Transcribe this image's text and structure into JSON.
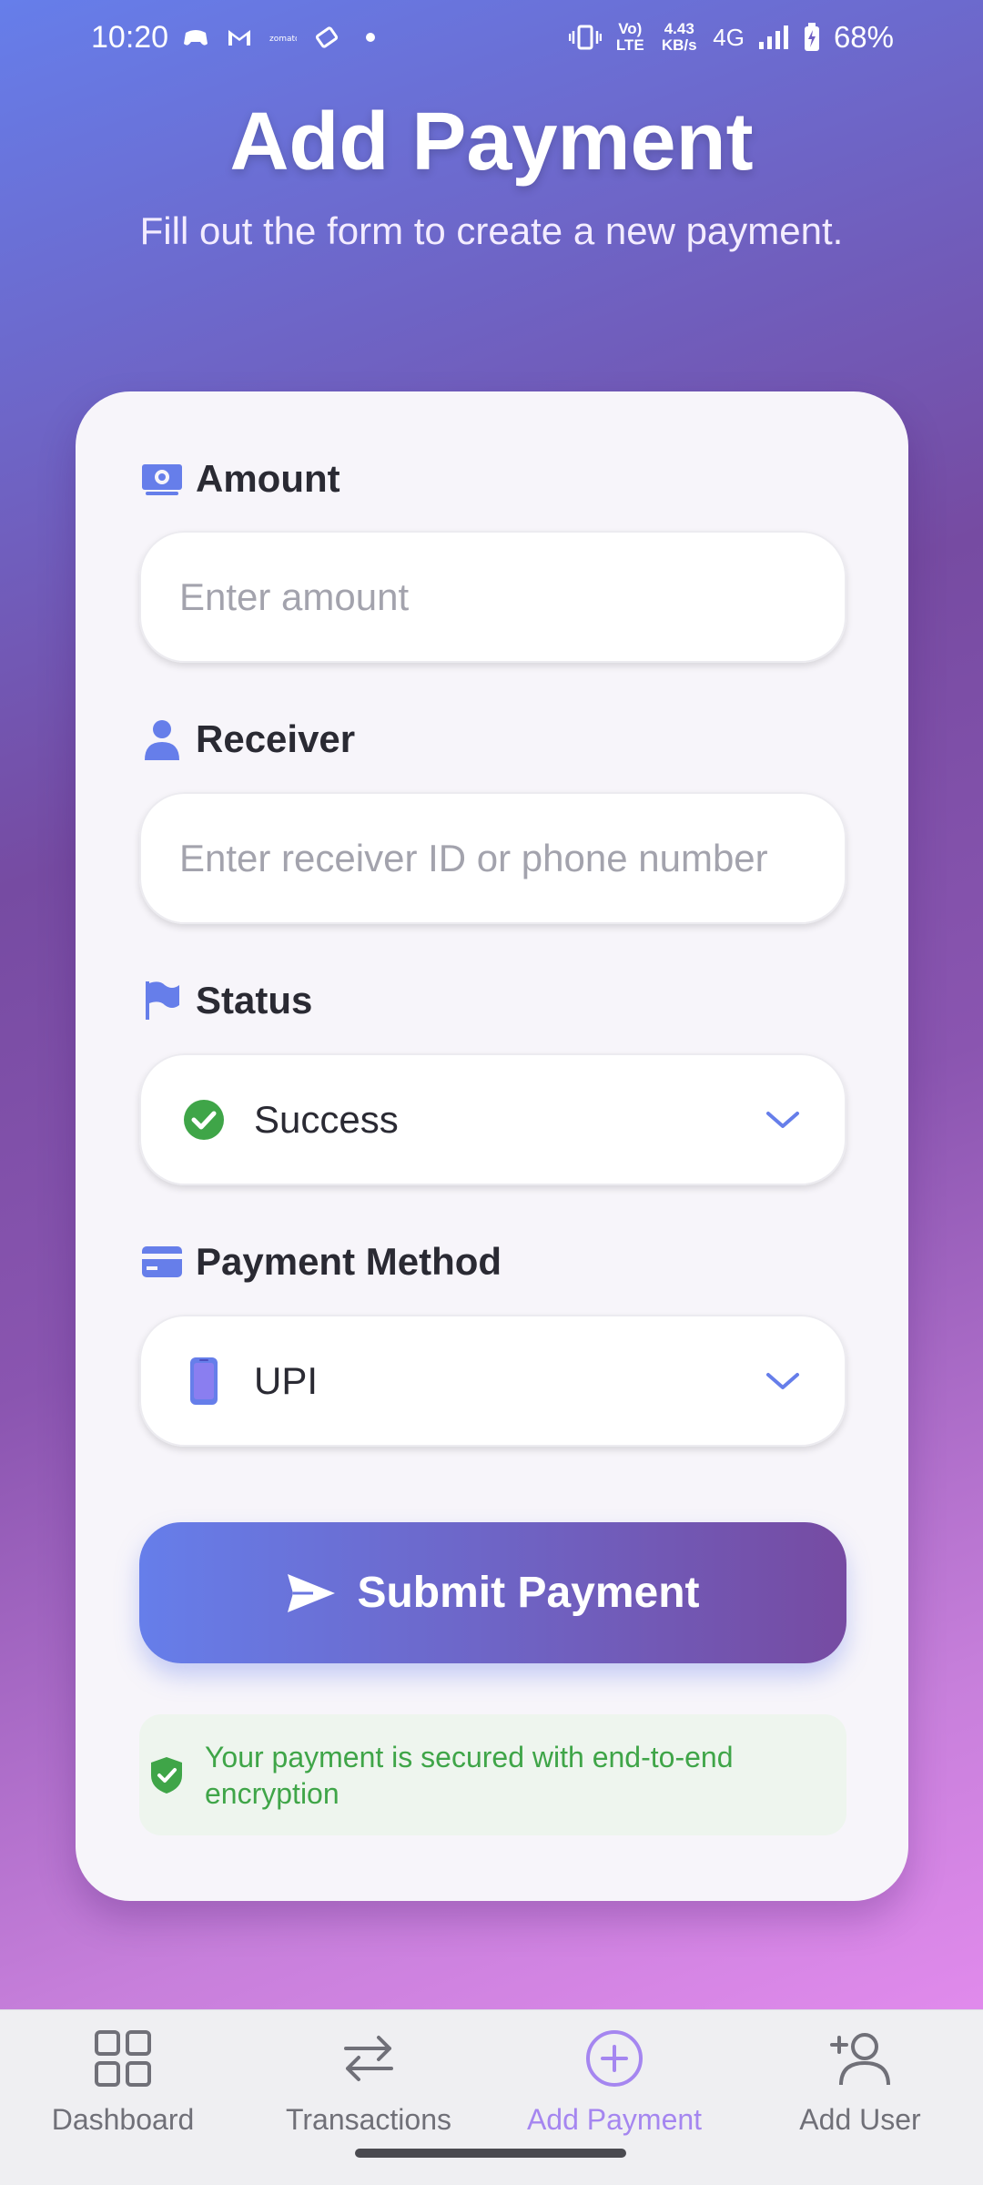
{
  "status_bar": {
    "time": "10:20",
    "network_lte": "Vo) LTE",
    "speed": "4.43 KB/s",
    "network": "4G",
    "battery": "68%"
  },
  "header": {
    "title": "Add Payment",
    "subtitle": "Fill out the form to create a new payment."
  },
  "form": {
    "amount": {
      "label": "Amount",
      "placeholder": "Enter amount",
      "icon": "money-icon"
    },
    "receiver": {
      "label": "Receiver",
      "placeholder": "Enter receiver ID or phone number",
      "icon": "person-icon"
    },
    "status": {
      "label": "Status",
      "selected": "Success",
      "icon": "flag-icon",
      "option_icon": "check-circle-icon"
    },
    "payment_method": {
      "label": "Payment Method",
      "selected": "UPI",
      "icon": "card-icon",
      "option_icon": "phone-icon"
    },
    "submit_label": "Submit Payment",
    "secure_note": "Your payment is secured with end-to-end encryption"
  },
  "bottom_nav": {
    "items": [
      {
        "label": "Dashboard",
        "icon": "grid-icon",
        "active": false
      },
      {
        "label": "Transactions",
        "icon": "swap-icon",
        "active": false
      },
      {
        "label": "Add Payment",
        "icon": "plus-circle-icon",
        "active": true
      },
      {
        "label": "Add User",
        "icon": "add-user-icon",
        "active": false
      }
    ]
  },
  "colors": {
    "accent": "#667eea",
    "accent_dark": "#764ba2",
    "success": "#3fa548",
    "active_nav": "#a586f0"
  }
}
